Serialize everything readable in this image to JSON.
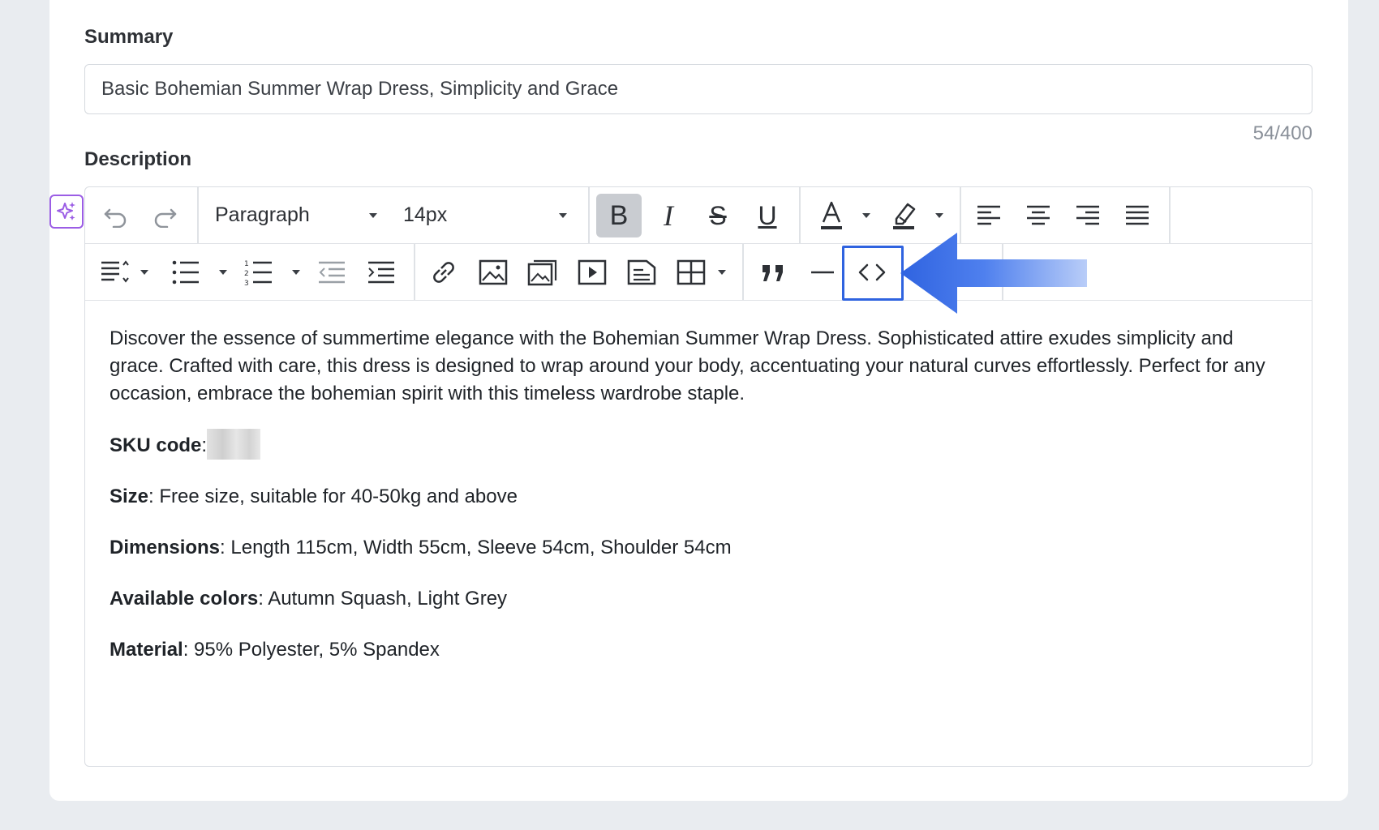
{
  "summary": {
    "label": "Summary",
    "value": "Basic Bohemian Summer Wrap Dress, Simplicity and Grace",
    "counter": "54/400"
  },
  "description": {
    "label": "Description",
    "toolbar": {
      "block_format": "Paragraph",
      "font_size": "14px",
      "bold_active": true,
      "highlighted_button": "source-code-button",
      "accent_color": "#2f63e0"
    },
    "content": {
      "intro": "Discover the essence of summertime elegance with the Bohemian Summer Wrap Dress. Sophisticated attire exudes simplicity and grace. Crafted with care, this dress is designed to wrap around your body, accentuating your natural curves effortlessly. Perfect for any occasion, embrace the bohemian spirit with this timeless wardrobe staple.",
      "sku_label": "SKU code",
      "size_label": "Size",
      "size_value": "Free size, suitable for 40-50kg and above",
      "dimensions_label": "Dimensions",
      "dimensions_value": "Length 115cm, Width 55cm, Sleeve 54cm, Shoulder 54cm",
      "colors_label": "Available colors",
      "colors_value": "Autumn Squash, Light Grey",
      "material_label": "Material",
      "material_value": "95% Polyester, 5% Spandex"
    }
  }
}
